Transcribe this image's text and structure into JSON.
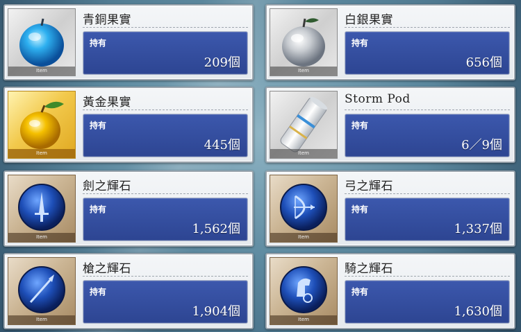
{
  "thumbnail_tag": "Item",
  "held_label": "持有",
  "items": [
    {
      "name": "青銅果實",
      "count": "209個",
      "icon": "blue-apple-icon"
    },
    {
      "name": "白銀果實",
      "count": "656個",
      "icon": "silver-apple-icon"
    },
    {
      "name": "黃金果實",
      "count": "445個",
      "icon": "gold-apple-icon"
    },
    {
      "name": "Storm Pod",
      "count": "6／9個",
      "icon": "storm-pod-can-icon"
    },
    {
      "name": "劍之輝石",
      "count": "1,562個",
      "icon": "saber-gem-icon"
    },
    {
      "name": "弓之輝石",
      "count": "1,337個",
      "icon": "archer-gem-icon"
    },
    {
      "name": "槍之輝石",
      "count": "1,904個",
      "icon": "lancer-gem-icon"
    },
    {
      "name": "騎之輝石",
      "count": "1,630個",
      "icon": "rider-gem-icon"
    }
  ],
  "colors": {
    "panel_blue": "#3c58ad",
    "card_bg": "#f0f2f5",
    "gold_frame": "#f2c94c",
    "gem_blue": "#1e4fb8"
  }
}
